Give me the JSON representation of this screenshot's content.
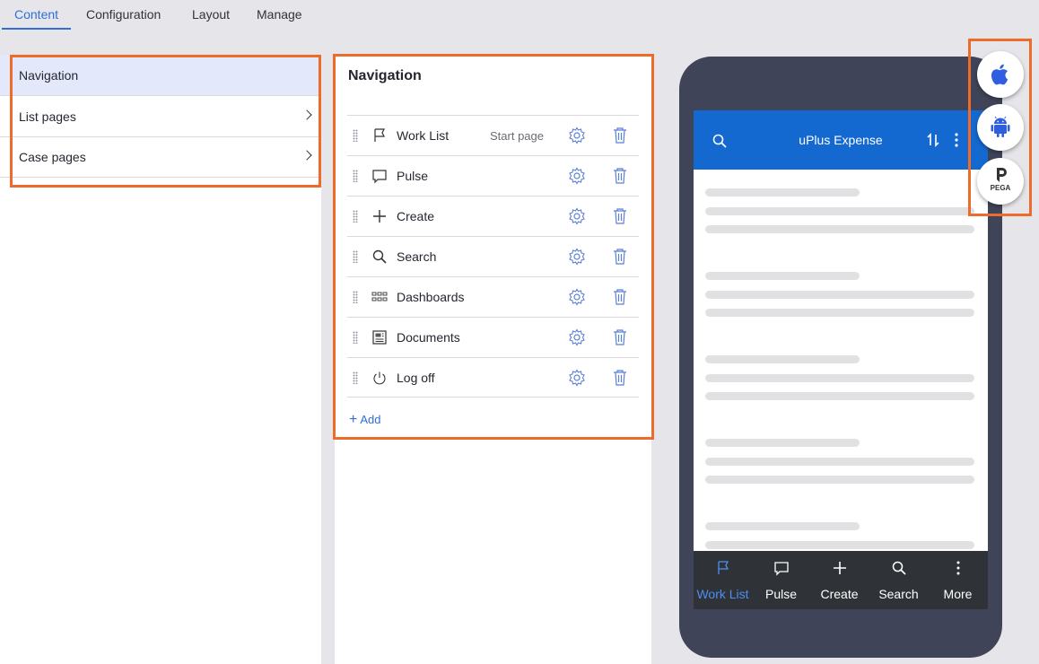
{
  "tabs": [
    {
      "label": "Content",
      "active": true
    },
    {
      "label": "Configuration",
      "active": false
    },
    {
      "label": "Layout",
      "active": false
    },
    {
      "label": "Manage",
      "active": false
    }
  ],
  "left_panel": {
    "items": [
      {
        "label": "Navigation",
        "selected": true,
        "icon": "none"
      },
      {
        "label": "List pages",
        "selected": false,
        "icon": "chevron-right-icon"
      },
      {
        "label": "Case pages",
        "selected": false,
        "icon": "chevron-right-icon"
      }
    ]
  },
  "navigation_panel": {
    "title": "Navigation",
    "rows": [
      {
        "label": "Work List",
        "icon": "flag-icon",
        "tag": "Start page"
      },
      {
        "label": "Pulse",
        "icon": "speech-bubble-icon",
        "tag": ""
      },
      {
        "label": "Create",
        "icon": "plus-icon",
        "tag": ""
      },
      {
        "label": "Search",
        "icon": "search-icon",
        "tag": ""
      },
      {
        "label": "Dashboards",
        "icon": "grid-icon",
        "tag": ""
      },
      {
        "label": "Documents",
        "icon": "document-icon",
        "tag": ""
      },
      {
        "label": "Log off",
        "icon": "power-icon",
        "tag": ""
      }
    ],
    "add_label": "Add"
  },
  "phone_preview": {
    "app_title": "uPlus Expense",
    "header_color": "#1469d1",
    "bottom_nav": [
      {
        "label": "Work List",
        "icon": "flag-icon",
        "active": true
      },
      {
        "label": "Pulse",
        "icon": "speech-bubble-icon",
        "active": false
      },
      {
        "label": "Create",
        "icon": "plus-icon",
        "active": false
      },
      {
        "label": "Search",
        "icon": "search-icon",
        "active": false
      },
      {
        "label": "More",
        "icon": "more-vertical-icon",
        "active": false
      }
    ]
  },
  "platforms": [
    {
      "name": "iOS",
      "icon": "apple-icon"
    },
    {
      "name": "Android",
      "icon": "android-icon"
    },
    {
      "name": "Pega",
      "icon": "pega-icon",
      "label": "PEGA"
    }
  ],
  "colors": {
    "accent": "#2f6fd6",
    "highlight": "#ee6c2b",
    "phone_frame": "#3f4458",
    "active_bottom_nav": "#4c8ef5"
  }
}
